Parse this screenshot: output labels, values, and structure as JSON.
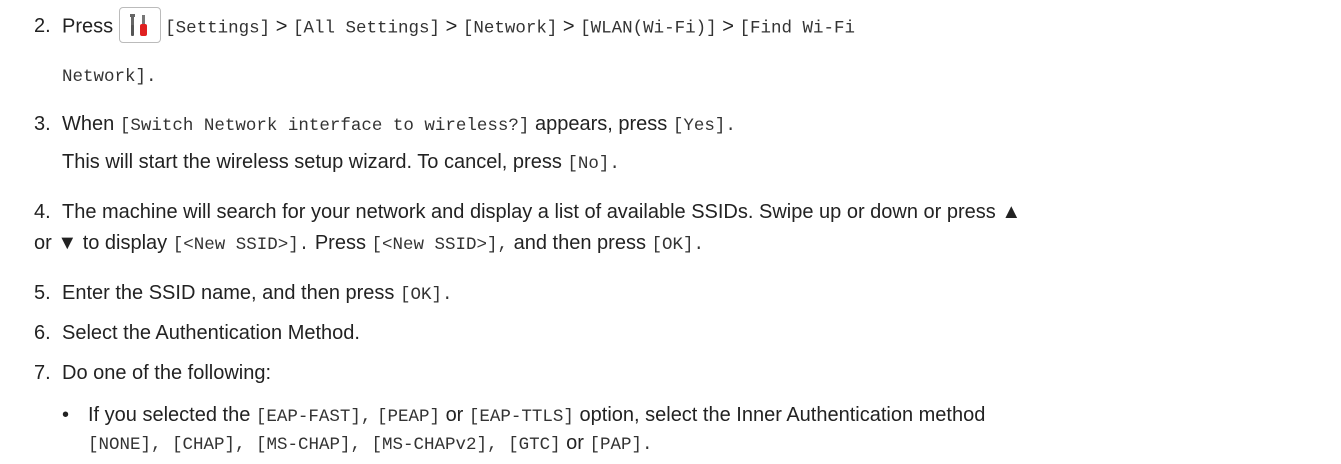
{
  "steps": [
    {
      "num": "2.",
      "t1": "Press",
      "t2": "[Settings]",
      "t3": ">",
      "t4": "[All Settings]",
      "t5": ">",
      "t6": "[Network]",
      "t7": ">",
      "t8": "[WLAN(Wi-Fi)]",
      "t9": ">",
      "t10": "[Find Wi-Fi",
      "t11": "Network]."
    },
    {
      "num": "3.",
      "t1": "When",
      "t2": "[Switch Network interface to wireless?]",
      "t3": "appears, press",
      "t4": "[Yes].",
      "t5": "This will start the wireless setup wizard. To cancel, press",
      "t6": "[No]."
    },
    {
      "num": "4.",
      "t1": "The machine will search for your network and display a list of available SSIDs. Swipe up or down or press ▲",
      "t2": "or ▼ to display",
      "t3": "[<New SSID>].",
      "t4": "Press",
      "t5": "[<New SSID>],",
      "t6": "and then press",
      "t7": "[OK]."
    },
    {
      "num": "5.",
      "t1": "Enter the SSID name, and then press",
      "t2": "[OK]."
    },
    {
      "num": "6.",
      "t1": "Select the Authentication Method."
    },
    {
      "num": "7.",
      "t1": "Do one of the following:"
    }
  ],
  "bullet": {
    "mark": "•",
    "t1": "If you selected the",
    "t2": "[EAP-FAST],",
    "t3": "[PEAP]",
    "t4": "or",
    "t5": "[EAP-TTLS]",
    "t6": "option, select the Inner Authentication method",
    "t7": "[NONE], [CHAP], [MS-CHAP], [MS-CHAPv2], [GTC]",
    "t8": "or",
    "t9": "[PAP]."
  },
  "icons": {
    "settings": "settings-tools-icon"
  }
}
